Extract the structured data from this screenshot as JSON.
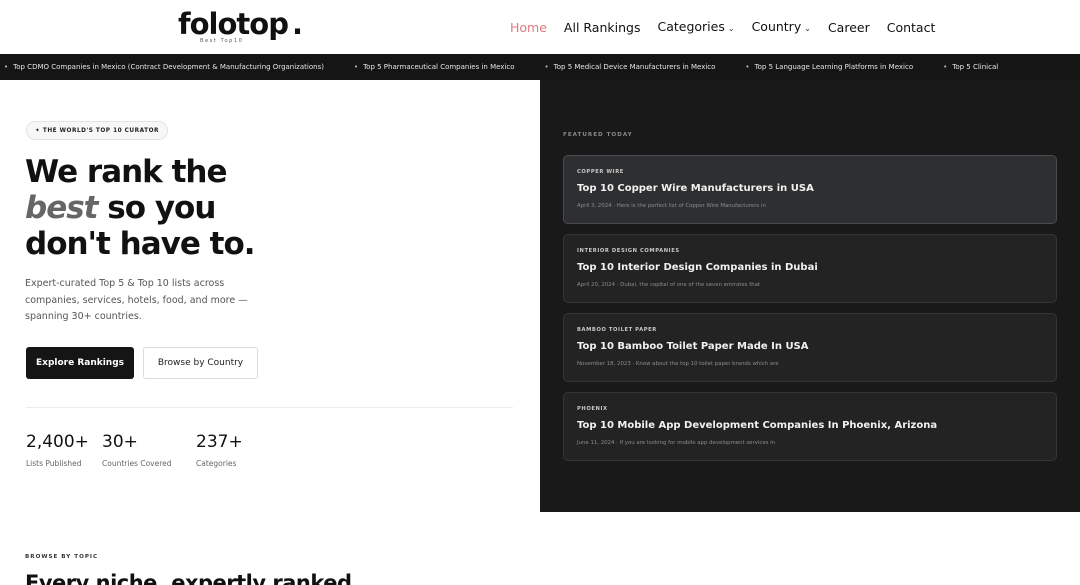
{
  "header": {
    "logo": {
      "name": "folotop",
      "dot": ".",
      "tagline": "Best Top10"
    },
    "nav": [
      {
        "label": "Home",
        "active": true,
        "dropdown": false
      },
      {
        "label": "All Rankings",
        "active": false,
        "dropdown": false
      },
      {
        "label": "Categories",
        "active": false,
        "dropdown": true
      },
      {
        "label": "Country",
        "active": false,
        "dropdown": true
      },
      {
        "label": "Career",
        "active": false,
        "dropdown": false
      },
      {
        "label": "Contact",
        "active": false,
        "dropdown": false
      }
    ]
  },
  "ticker": [
    "Top CDMO Companies in Mexico (Contract Development & Manufacturing Organizations)",
    "Top 5 Pharmaceutical Companies in Mexico",
    "Top 5 Medical Device Manufacturers in Mexico",
    "Top 5 Language Learning Platforms in Mexico",
    "Top 5 Clinical"
  ],
  "hero": {
    "badge": "✦ THE WORLD'S TOP 10 CURATOR",
    "title_line1": "We rank the",
    "title_em": "best",
    "title_line2_rest": " so you",
    "title_line3": "don't have to.",
    "description": "Expert-curated Top 5 & Top 10 lists across companies, services, hotels, food, and more — spanning 30+ countries.",
    "primary_button": "Explore Rankings",
    "secondary_button": "Browse by Country",
    "stats": [
      {
        "value": "2,400+",
        "label": "Lists Published"
      },
      {
        "value": "30+",
        "label": "Countries Covered"
      },
      {
        "value": "237+",
        "label": "Categories"
      }
    ]
  },
  "featured": {
    "label": "FEATURED TODAY",
    "cards": [
      {
        "category": "COPPER WIRE",
        "title": "Top 10 Copper Wire Manufacturers in USA",
        "meta": "April 3, 2024 · Here is the perfect list of Copper Wire Manufacturers in"
      },
      {
        "category": "INTERIOR DESIGN COMPANIES",
        "title": "Top 10 Interior Design Companies in Dubai",
        "meta": "April 20, 2024 · Dubai, the capital of one of the seven emirates that"
      },
      {
        "category": "BAMBOO TOILET PAPER",
        "title": "Top 10 Bamboo Toilet Paper Made In USA",
        "meta": "November 18, 2023 · Know about the top 10 toilet paper brands which are"
      },
      {
        "category": "PHOENIX",
        "title": "Top 10 Mobile App Development Companies In Phoenix, Arizona",
        "meta": "June 11, 2024 · If you are looking for mobile app development services in"
      }
    ]
  },
  "browse": {
    "kicker": "BROWSE BY TOPIC",
    "title": "Every niche, expertly ranked."
  },
  "colors": {
    "accent_nav_active": "#e2787e",
    "dark_panel": "#19191a",
    "ticker_bg": "#151516"
  }
}
